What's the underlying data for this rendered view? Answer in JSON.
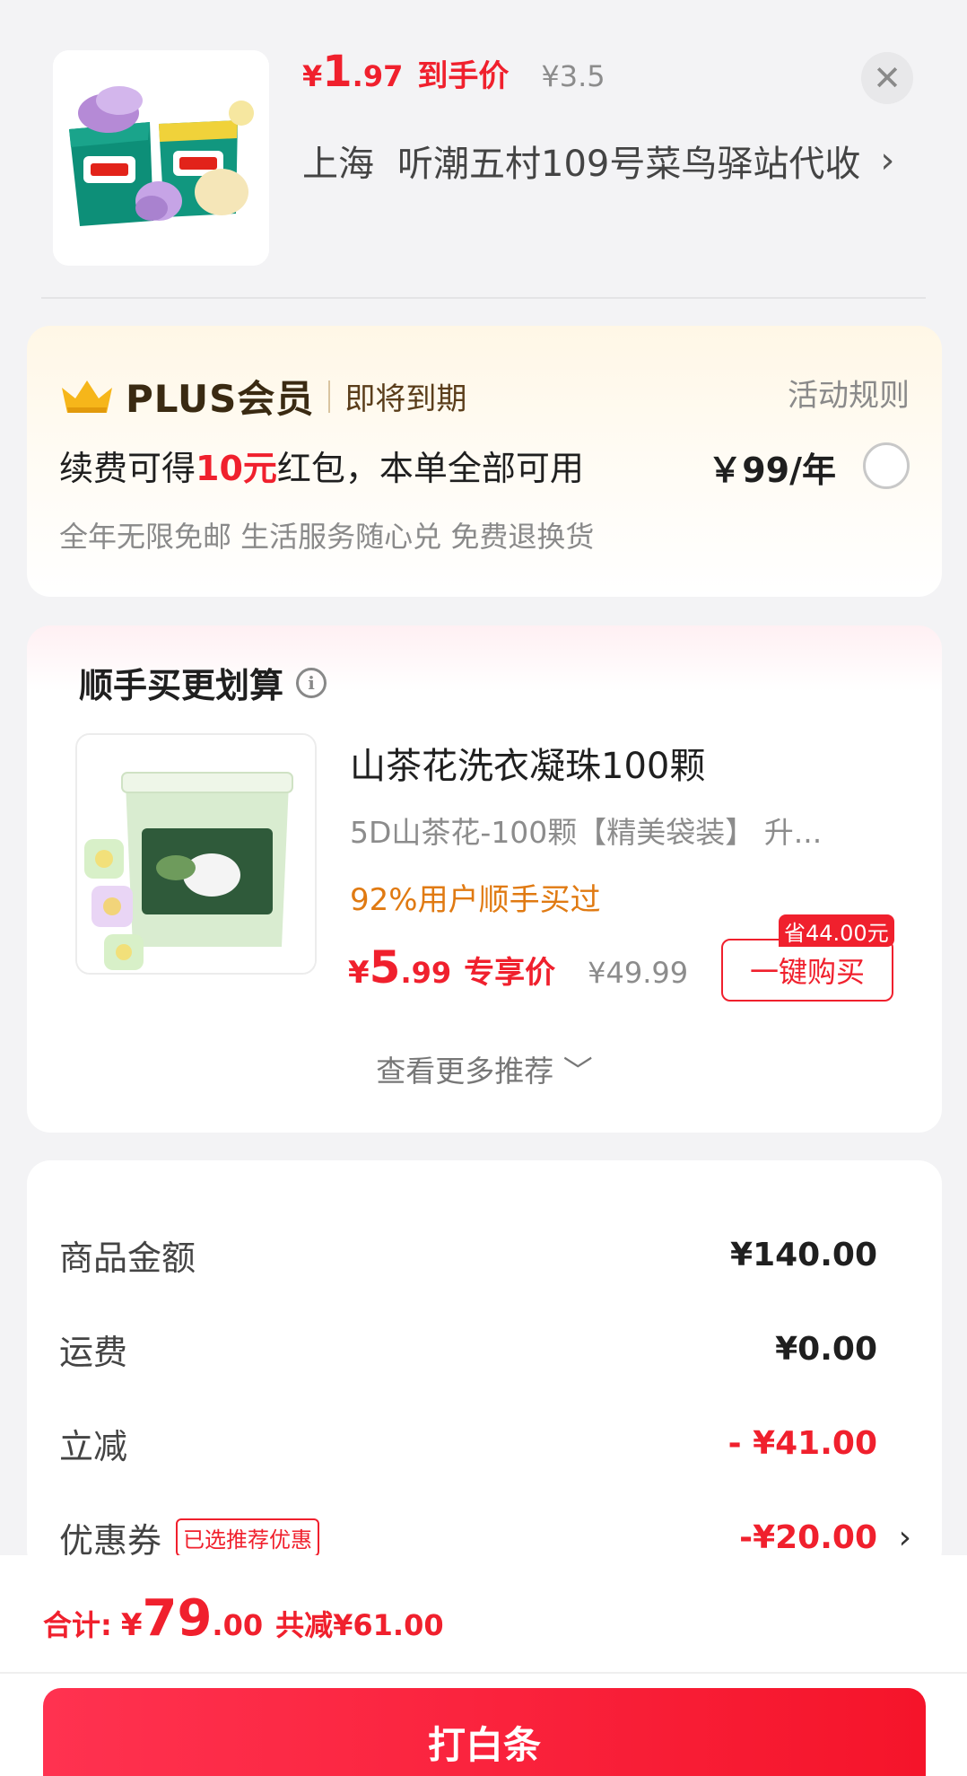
{
  "colors": {
    "accent_red": "#f0202d",
    "plus_gold": "#f6b61a",
    "recommend_orange": "#e07a12"
  },
  "header": {
    "price_yen": "¥",
    "price_int": "1",
    "price_dec": ".97",
    "price_tag": "到手价",
    "original_price": "¥3.5",
    "close_icon": "close-icon",
    "address_city": "上海",
    "address_detail": "听潮五村109号菜鸟驿站代收",
    "address_chevron": "›"
  },
  "plus": {
    "title": "PLUS会员",
    "expire": "即将到期",
    "rules": "活动规则",
    "offer_prefix": "续费可得",
    "offer_highlight": "10元",
    "offer_suffix": "红包，本单全部可用",
    "price": "￥99/年",
    "benefits": "全年无限免邮 生活服务随心兑 免费退换货"
  },
  "recommend": {
    "title": "顺手买更划算",
    "info_icon": "info-icon",
    "product": {
      "name": "山茶花洗衣凝珠100颗",
      "spec": "5D山茶花-100颗【精美袋装】  升...",
      "stat": "92%用户顺手买过",
      "price_yen": "¥",
      "price_int": "5",
      "price_dec": ".99",
      "price_tag": "专享价",
      "original_price": "¥49.99",
      "save_badge": "省44.00元",
      "buy_button": "一键购买"
    },
    "more": "查看更多推荐 ﹀"
  },
  "summary": {
    "rows": [
      {
        "label": "商品金额",
        "value": "¥140.00"
      },
      {
        "label": "运费",
        "value": "¥0.00"
      },
      {
        "label": "立减",
        "value": "- ¥41.00"
      },
      {
        "label": "优惠券",
        "tag": "已选推荐优惠",
        "value": "-¥20.00",
        "chevron": "›"
      }
    ]
  },
  "bottom": {
    "total_label": "合计:",
    "total_yen": "¥",
    "total_int": "79",
    "total_dec": ".00",
    "total_reduce": "共减¥61.00",
    "pay_button": "打白条"
  }
}
